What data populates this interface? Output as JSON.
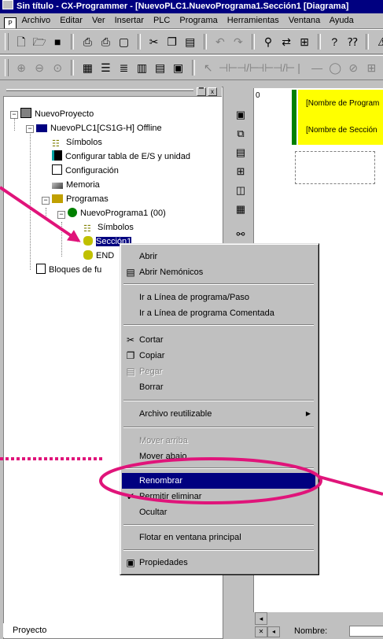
{
  "window": {
    "title": "Sin título - CX-Programmer - [NuevoPLC1.NuevoPrograma1.Sección1 [Diagrama]"
  },
  "menubar": [
    "Archivo",
    "Editar",
    "Ver",
    "Insertar",
    "PLC",
    "Programa",
    "Herramientas",
    "Ventana",
    "Ayuda"
  ],
  "tree": {
    "items": [
      {
        "label": "NuevoProyecto"
      },
      {
        "label": "NuevoPLC1[CS1G-H] Offline"
      },
      {
        "label": "Símbolos"
      },
      {
        "label": "Configurar tabla de E/S y unidad"
      },
      {
        "label": "Configuración"
      },
      {
        "label": "Memoria"
      },
      {
        "label": "Programas"
      },
      {
        "label": "NuevoPrograma1 (00)"
      },
      {
        "label": "Símbolos"
      },
      {
        "label": "Sección1"
      },
      {
        "label": "END"
      },
      {
        "label": "Bloques de fu"
      }
    ],
    "bottom_tab": "Proyecto",
    "close_glyph": "x"
  },
  "ladder": {
    "row_number": "0",
    "program_name": "[Nombre de Program",
    "section_name": "[Nombre de Sección"
  },
  "status": {
    "name_label": "Nombre:"
  },
  "context_menu": {
    "items": [
      {
        "label": "Abrir",
        "disabled": false
      },
      {
        "label": "Abrir Nemónicos",
        "disabled": false
      },
      {
        "label": "Ir a Línea de programa/Paso",
        "disabled": false
      },
      {
        "label": "Ir a Línea de programa Comentada",
        "disabled": false
      },
      {
        "label": "Cortar",
        "disabled": false
      },
      {
        "label": "Copiar",
        "disabled": false
      },
      {
        "label": "Pegar",
        "disabled": true
      },
      {
        "label": "Borrar",
        "disabled": false
      },
      {
        "label": "Archivo reutilizable",
        "disabled": false
      },
      {
        "label": "Mover arriba",
        "disabled": true
      },
      {
        "label": "Mover abajo",
        "disabled": false
      },
      {
        "label": "Renombrar",
        "disabled": false
      },
      {
        "label": "Permitir eliminar",
        "disabled": false
      },
      {
        "label": "Ocultar",
        "disabled": false
      },
      {
        "label": "Flotar en ventana principal",
        "disabled": false
      },
      {
        "label": "Propiedades",
        "disabled": false
      }
    ]
  },
  "colors": {
    "annotation": "#e0147a",
    "selection": "#000080",
    "ladder_label_bg": "#ffff00",
    "rail": "#008000"
  }
}
